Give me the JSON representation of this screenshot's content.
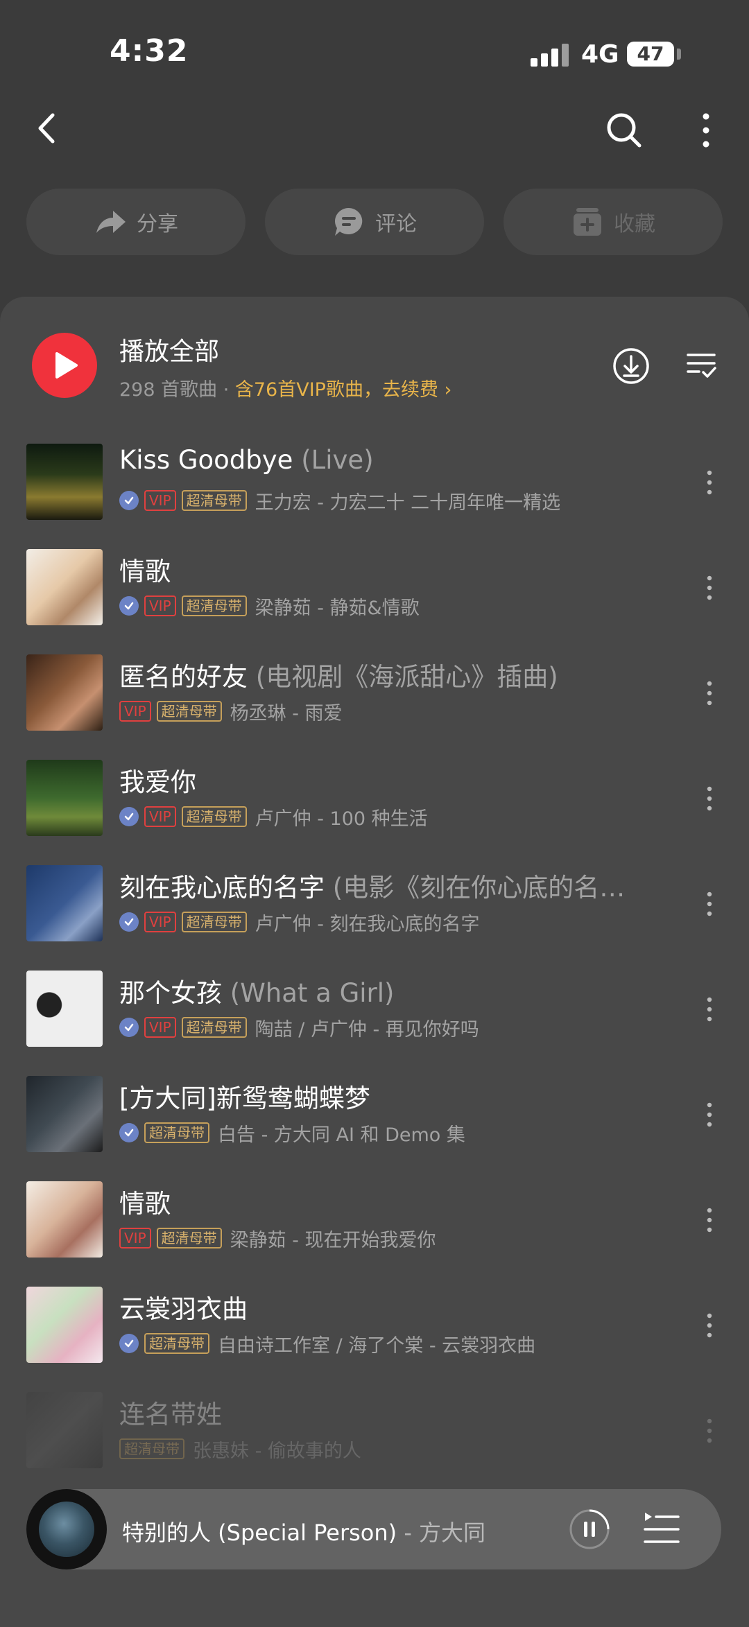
{
  "status": {
    "time": "4:32",
    "network": "4G",
    "battery": "47"
  },
  "actions": [
    {
      "label": "分享",
      "icon": "share-icon"
    },
    {
      "label": "评论",
      "icon": "comment-icon"
    },
    {
      "label": "收藏",
      "icon": "collect-icon"
    }
  ],
  "playall": {
    "title": "播放全部",
    "count": "298 首歌曲 · ",
    "vip_note": "含76首VIP歌曲，去续费 ›"
  },
  "songs": [
    {
      "title": "Kiss Goodbye",
      "subtitle": " (Live)",
      "verified": true,
      "vip": "VIP",
      "hq": "超清母带",
      "artist": "王力宏 - 力宏二十 二十周年唯一精选"
    },
    {
      "title": "情歌",
      "subtitle": "",
      "verified": true,
      "vip": "VIP",
      "hq": "超清母带",
      "artist": "梁静茹 - 静茹&情歌"
    },
    {
      "title": "匿名的好友",
      "subtitle": " (电视剧《海派甜心》插曲)",
      "verified": false,
      "vip": "VIP",
      "hq": "超清母带",
      "artist": "杨丞琳 - 雨爱"
    },
    {
      "title": "我爱你",
      "subtitle": "",
      "verified": true,
      "vip": "VIP",
      "hq": "超清母带",
      "artist": "卢广仲 - 100 种生活"
    },
    {
      "title": "刻在我心底的名字",
      "subtitle": " (电影《刻在你心底的名…",
      "verified": true,
      "vip": "VIP",
      "hq": "超清母带",
      "artist": "卢广仲 - 刻在我心底的名字"
    },
    {
      "title": "那个女孩",
      "subtitle": " (What a Girl)",
      "verified": true,
      "vip": "VIP",
      "hq": "超清母带",
      "artist": "陶喆 / 卢广仲 - 再见你好吗"
    },
    {
      "title": "[方大同]新鸳鸯蝴蝶梦",
      "subtitle": "",
      "verified": true,
      "vip": "",
      "hq": "超清母带",
      "artist": "白告 - 方大同 AI 和 Demo 集"
    },
    {
      "title": "情歌",
      "subtitle": "",
      "verified": false,
      "vip": "VIP",
      "hq": "超清母带",
      "artist": "梁静茹 - 现在开始我爱你"
    },
    {
      "title": "云裳羽衣曲",
      "subtitle": "",
      "verified": true,
      "vip": "",
      "hq": "超清母带",
      "artist": "自由诗工作室 / 海了个棠 - 云裳羽衣曲"
    },
    {
      "title": "连名带姓",
      "subtitle": "",
      "verified": false,
      "vip": "",
      "hq": "超清母带",
      "artist": "张惠妹 - 偷故事的人"
    }
  ],
  "player": {
    "title": "特别的人 (Special Person)",
    "artist": " - 方大同"
  }
}
